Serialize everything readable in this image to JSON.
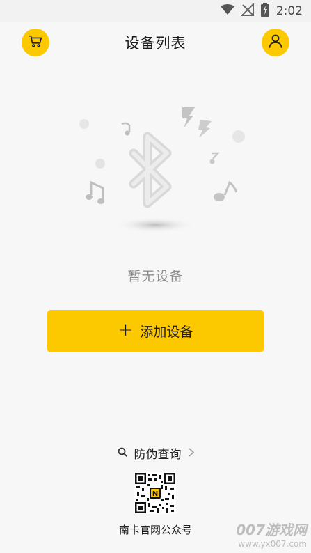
{
  "status_bar": {
    "time": "2:02"
  },
  "header": {
    "title": "设备列表"
  },
  "empty_state": {
    "message": "暂无设备"
  },
  "actions": {
    "add_device_label": "添加设备",
    "add_icon": "+"
  },
  "footer": {
    "anti_fake_label": "防伪查询",
    "qr_caption": "南卡官网公众号",
    "qr_center_letter": "N"
  },
  "watermark": {
    "title": "007游戏网",
    "url": "www.yx007.com"
  },
  "colors": {
    "accent": "#fcc800",
    "background": "#f7f7f7",
    "muted_text": "#8c8c8c"
  }
}
